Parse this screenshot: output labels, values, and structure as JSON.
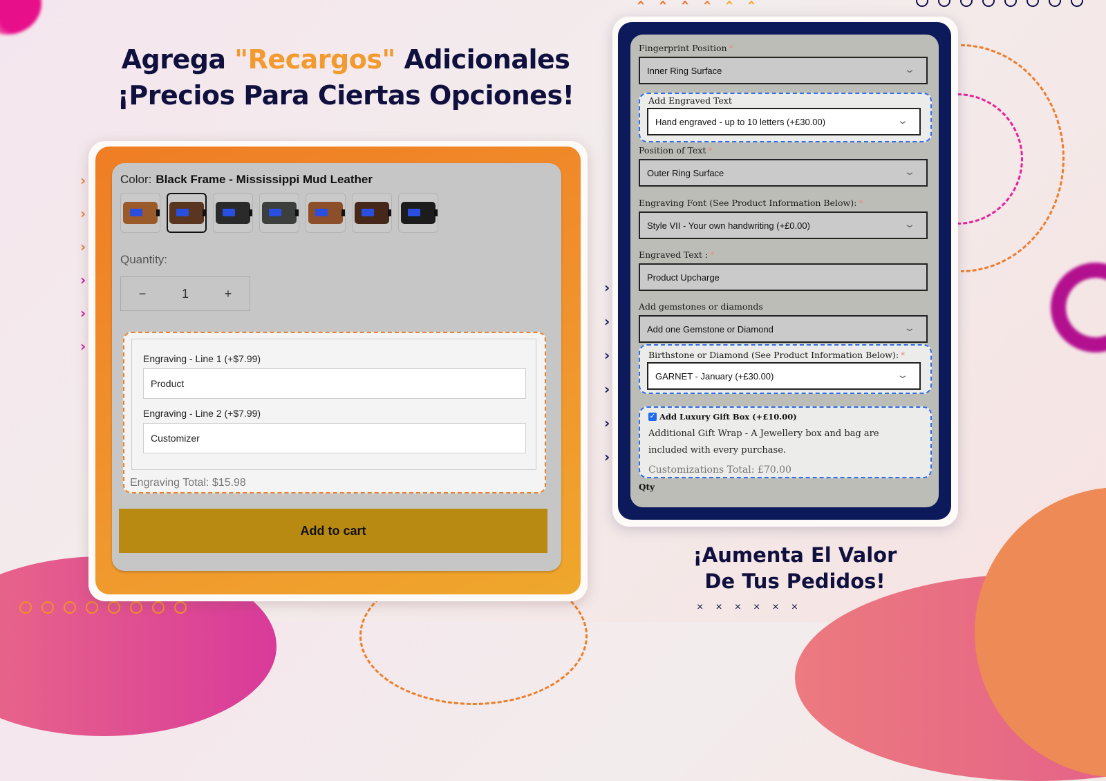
{
  "headline": {
    "part1": "Agrega ",
    "accent": "\"Recargos\"",
    "part2": " Adicionales",
    "line2": "¡Precios Para Ciertas Opciones!"
  },
  "subheadline": {
    "line1": "¡Aumenta El Valor",
    "line2": "De Tus Pedidos!"
  },
  "colors": {
    "navy": "#10103f",
    "accent_orange": "#f29a2e",
    "left_frame": "#ef7d24",
    "right_frame": "#0c1a5c",
    "cart_button": "#b98a12",
    "highlight_orange": "#ef7d24",
    "highlight_blue": "#2b6cf0"
  },
  "left_product": {
    "color_label": "Color:",
    "color_value": "Black Frame - Mississippi Mud Leather",
    "swatches": [
      {
        "name": "tan leather",
        "color": "#9a5a2a",
        "selected": false
      },
      {
        "name": "mississippi mud",
        "color": "#5a3520",
        "selected": true
      },
      {
        "name": "black",
        "color": "#2a2a2a",
        "selected": false
      },
      {
        "name": "charcoal",
        "color": "#3c3f3c",
        "selected": false
      },
      {
        "name": "saddle",
        "color": "#8c4f2a",
        "selected": false
      },
      {
        "name": "dark brown",
        "color": "#45281a",
        "selected": false
      },
      {
        "name": "jet black",
        "color": "#1c1c1c",
        "selected": false
      }
    ],
    "quantity_label": "Quantity:",
    "quantity": {
      "minus": "−",
      "value": "1",
      "plus": "+"
    },
    "engraving": {
      "line1_label": "Engraving - Line 1 (+$7.99)",
      "line1_value": "Product",
      "line2_label": "Engraving - Line 2 (+$7.99)",
      "line2_value": "Customizer",
      "total": "Engraving Total: $15.98"
    },
    "add_to_cart": "Add to cart"
  },
  "right_product": {
    "fingerprint_label": "Fingerprint Position",
    "fingerprint_value": "Inner Ring Surface",
    "engraved_text_option_label": "Add Engraved Text",
    "engraved_text_option_value": "Hand engraved - up to 10 letters (+£30.00)",
    "position_label": "Position of Text",
    "position_value": "Outer Ring Surface",
    "font_label": "Engraving Font (See Product Information Below):",
    "font_value": "Style VII - Your own handwriting (+£0.00)",
    "engraved_text_label": "Engraved Text :",
    "engraved_text_value": "Product Upcharge",
    "gem_label": "Add gemstones or diamonds",
    "gem_value": "Add one Gemstone or Diamond",
    "birthstone_label": "Birthstone or Diamond (See Product Information Below):",
    "birthstone_value": "GARNET - January (+£30.00)",
    "gift_label": "Add Luxury Gift Box (+£10.00)",
    "gift_checked": true,
    "gift_description": "Additional Gift Wrap - A Jewellery box and bag are included with every purchase.",
    "customizations_total": "Customizations Total: £70.00",
    "qty_label": "Qty",
    "required_mark": "*",
    "dropdown_icon": "⌄",
    "checkbox_icon": "✓"
  }
}
